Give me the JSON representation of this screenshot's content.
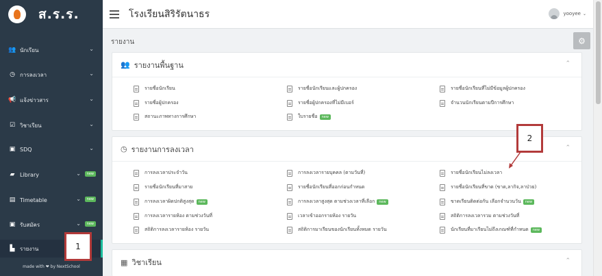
{
  "sidebar": {
    "brand": "ส.ร.ร.",
    "items": [
      {
        "label": "นักเรียน",
        "icon": "users-icon",
        "glyph": "👥"
      },
      {
        "label": "การลงเวลา",
        "icon": "clock-icon",
        "glyph": "◷"
      },
      {
        "label": "แจ้งข่าวสาร",
        "icon": "megaphone-icon",
        "glyph": "📢"
      },
      {
        "label": "วิชาเรียน",
        "icon": "calendar-check-icon",
        "glyph": "☑"
      },
      {
        "label": "SDQ",
        "icon": "id-card-icon",
        "glyph": "▣"
      },
      {
        "label": "Library",
        "icon": "book-icon",
        "glyph": "▰",
        "badge": "new"
      },
      {
        "label": "Timetable",
        "icon": "table-icon",
        "glyph": "▤",
        "badge": "new"
      },
      {
        "label": "รับสมัคร",
        "icon": "id-card-icon",
        "glyph": "▣",
        "badge": "new"
      },
      {
        "label": "รายงาน",
        "icon": "bar-chart-icon",
        "glyph": "▙"
      }
    ],
    "made_with": "made with ❤ by NextSchool"
  },
  "topbar": {
    "title": "โรงเรียนสิริรัตนาธร",
    "username": "yooyee"
  },
  "page": {
    "heading": "รายงาน"
  },
  "panels": [
    {
      "title": "รายงานพื้นฐาน",
      "icon": "users-icon",
      "links": [
        {
          "label": "รายชื่อนักเรียน"
        },
        {
          "label": "รายชื่อนักเรียนและผู้ปกครอง"
        },
        {
          "label": "รายชื่อนักเรียนที่ไม่มีข้อมูลผู้ปกครอง"
        },
        {
          "label": "รายชื่อผู้ปกครอง"
        },
        {
          "label": "รายชื่อผู้ปกครองที่ไม่มีเบอร์"
        },
        {
          "label": "จำนวนนักเรียนตามปีการศึกษา"
        },
        {
          "label": "สถานะภาพทางการศึกษา"
        },
        {
          "label": "ใบรายชื่อ",
          "badge": "new"
        }
      ]
    },
    {
      "title": "รายงานการลงเวลา",
      "icon": "clock-icon",
      "links": [
        {
          "label": "การลงเวลาประจำวัน"
        },
        {
          "label": "การลงเวลารายบุคคล (ตามวันที่)"
        },
        {
          "label": "รายชื่อนักเรียนไม่ลงเวลา"
        },
        {
          "label": "รายชื่อนักเรียนที่มาสาย"
        },
        {
          "label": "รายชื่อนักเรียนที่ออกก่อนกำหนด"
        },
        {
          "label": "รายชื่อนักเรียนที่ขาด (ขาด,ลากิจ,ลาป่วย)"
        },
        {
          "label": "การลงเวลาผิดปกติสูงสุด",
          "badge": "new"
        },
        {
          "label": "การลงเวลาสูงสุด ตามช่วงเวลาที่เลือก",
          "badge": "new"
        },
        {
          "label": "ขาดเรียนติดต่อกัน เลือกจำนวนวัน",
          "badge": "new"
        },
        {
          "label": "การลงเวลารายห้อง ตามช่วงวันที่"
        },
        {
          "label": "เวลาเข้าออกรายห้อง รายวัน"
        },
        {
          "label": "สถิติการลงเวลารวม ตามช่วงวันที่"
        },
        {
          "label": "สถิติการลงเวลารายห้อง รายวัน"
        },
        {
          "label": "สถิติการมาเรียนของนักเรียนทั้งหมด รายวัน"
        },
        {
          "label": "นักเรียนที่มาเรียนไม่ถึงเกณฑ์ที่กำหนด",
          "badge": "new"
        }
      ]
    },
    {
      "title": "วิชาเรียน",
      "icon": "grid-icon"
    }
  ],
  "annotations": {
    "box1": "1",
    "box2": "2",
    "color": "#b23a3a"
  },
  "colors": {
    "sidebar": "#2b3a48",
    "accent": "#1abc9c",
    "new_badge": "#5cb85c"
  }
}
